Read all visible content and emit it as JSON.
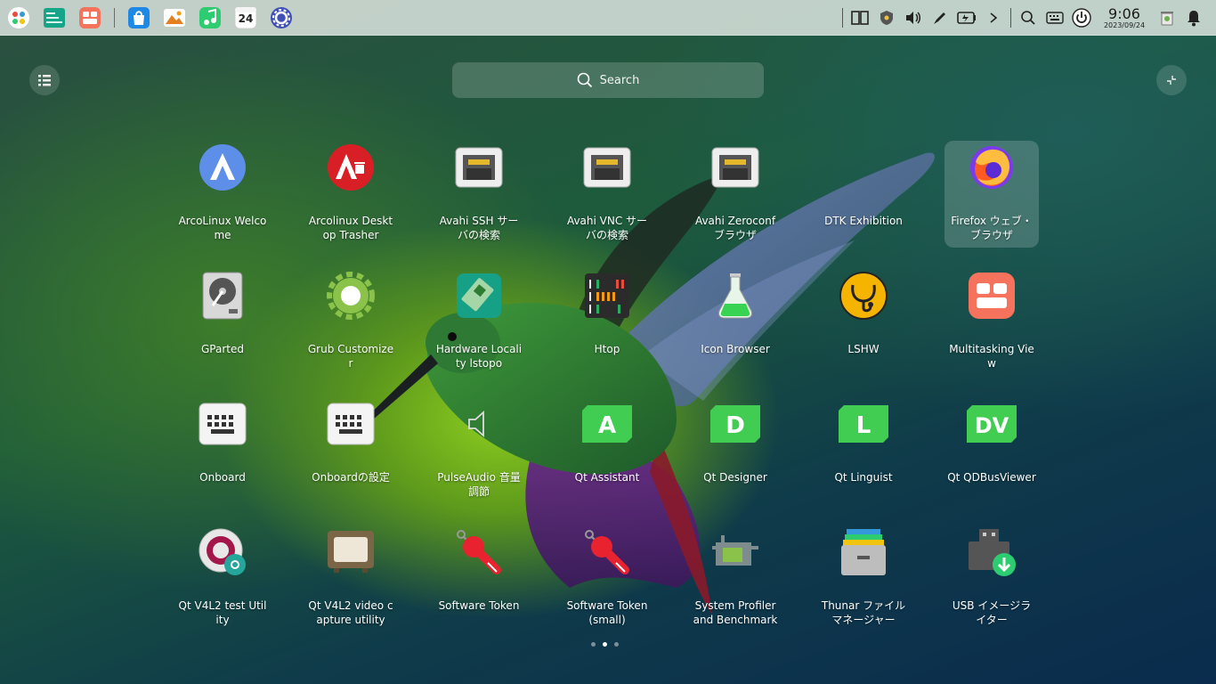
{
  "dock": {
    "apps": [
      {
        "name": "launcher-icon"
      },
      {
        "name": "terminal-icon"
      },
      {
        "name": "multitasking-icon"
      },
      {
        "name": "app-store-icon"
      },
      {
        "name": "photo-viewer-icon"
      },
      {
        "name": "music-icon"
      },
      {
        "name": "calendar-icon",
        "badge": "24"
      },
      {
        "name": "settings-icon"
      }
    ]
  },
  "tray": {
    "time": "9:06",
    "date": "2023/09/24"
  },
  "search": {
    "placeholder": "Search"
  },
  "apps": [
    {
      "label": "ArcoLinux Welcome",
      "icon": "arcolinux-icon"
    },
    {
      "label": "Arcolinux Desktop Trasher",
      "icon": "arcolinux-trasher-icon"
    },
    {
      "label": "Avahi SSH サーバの検索",
      "icon": "network-port-icon"
    },
    {
      "label": "Avahi VNC サーバの検索",
      "icon": "network-port-icon"
    },
    {
      "label": "Avahi Zeroconf ブラウザ",
      "icon": "network-port-icon"
    },
    {
      "label": "DTK Exhibition",
      "icon": "blank-icon"
    },
    {
      "label": "Firefox ウェブ・ブラウザ",
      "icon": "firefox-icon",
      "hover": true
    },
    {
      "label": "GParted",
      "icon": "hard-disk-icon"
    },
    {
      "label": "Grub Customizer",
      "icon": "gear-icon"
    },
    {
      "label": "Hardware Locality lstopo",
      "icon": "hardware-chip-icon"
    },
    {
      "label": "Htop",
      "icon": "htop-icon"
    },
    {
      "label": "Icon Browser",
      "icon": "flask-icon"
    },
    {
      "label": "LSHW",
      "icon": "stethoscope-icon"
    },
    {
      "label": "Multitasking View",
      "icon": "multitasking-icon"
    },
    {
      "label": "Onboard",
      "icon": "keyboard-icon"
    },
    {
      "label": "Onboardの設定",
      "icon": "keyboard-settings-icon"
    },
    {
      "label": "PulseAudio 音量調節",
      "icon": "speaker-icon"
    },
    {
      "label": "Qt Assistant",
      "icon": "qt-assistant-icon",
      "letter": "A"
    },
    {
      "label": "Qt Designer",
      "icon": "qt-designer-icon",
      "letter": "D"
    },
    {
      "label": "Qt Linguist",
      "icon": "qt-linguist-icon",
      "letter": "L"
    },
    {
      "label": "Qt QDBusViewer",
      "icon": "qt-dbusviewer-icon",
      "letter": "DV"
    },
    {
      "label": "Qt V4L2 test Utility",
      "icon": "webcam-settings-icon"
    },
    {
      "label": "Qt V4L2 video capture utility",
      "icon": "tv-icon"
    },
    {
      "label": "Software Token",
      "icon": "token-key-icon"
    },
    {
      "label": "Software Token (small)",
      "icon": "token-key-icon"
    },
    {
      "label": "System Profiler and Benchmark",
      "icon": "profiler-icon"
    },
    {
      "label": "Thunar ファイルマネージャー",
      "icon": "file-manager-icon"
    },
    {
      "label": "USB イメージライター",
      "icon": "usb-writer-icon"
    }
  ],
  "pager": {
    "pages": 3,
    "active": 2
  },
  "colors": {
    "qt_green": "#41cd52",
    "token_red": "#e8232f",
    "arco_blue": "#5d8ee8"
  }
}
